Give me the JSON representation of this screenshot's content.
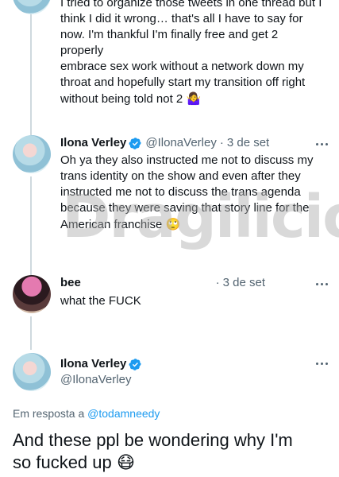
{
  "tweets": [
    {
      "text_lines": [
        "I tried to organize those tweets in one thread but I",
        "think I did it wrong… that's all I have to say for",
        "now. I'm thankful I'm finally free and get 2 properly",
        "embrace sex work without a network down my",
        "throat and hopefully start my transition off right",
        "without being told not 2"
      ],
      "emoji": "🤷‍♀️"
    },
    {
      "name": "Ilona Verley",
      "handle": "@IlonaVerley",
      "separator": "·",
      "date": "3 de set",
      "text_lines": [
        "Oh ya they also instructed me not to discuss my",
        "trans identity on the show and even after they",
        "instructed me not to discuss the trans agenda",
        "because they were saving that story line for the",
        "American franchise"
      ],
      "emoji": "🙄"
    },
    {
      "name": "bee",
      "separator": "·",
      "date": "3 de set",
      "text_lines": [
        "what the FUCK"
      ]
    }
  ],
  "main_tweet": {
    "name": "Ilona Verley",
    "handle": "@IlonaVerley",
    "reply_prefix": "Em resposta a",
    "reply_to": "@todamneedy",
    "text_lines": [
      "And these ppl be wondering why I'm",
      "so fucked up"
    ],
    "emoji": "😷"
  },
  "watermark": "Dragilicious",
  "colors": {
    "accent": "#1d9bf0",
    "secondary_text": "#536471",
    "thread_line": "#cfd9de"
  },
  "icons": [
    "verified-badge-icon",
    "more-options-icon"
  ]
}
